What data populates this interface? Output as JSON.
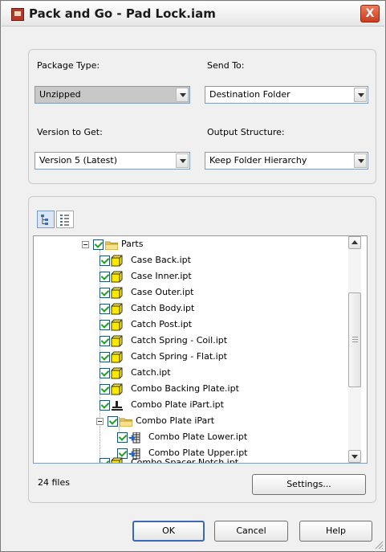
{
  "window": {
    "title": "Pack and Go - Pad Lock.iam",
    "close_label": "X",
    "icon": "app-icon"
  },
  "options": {
    "package_type": {
      "label": "Package Type:",
      "value": "Unzipped"
    },
    "send_to": {
      "label": "Send To:",
      "value": "Destination Folder"
    },
    "version": {
      "label": "Version to Get:",
      "value": "Version 5 (Latest)"
    },
    "output_structure": {
      "label": "Output Structure:",
      "value": "Keep Folder Hierarchy"
    }
  },
  "view_buttons": [
    {
      "name": "tree-view-icon",
      "active": true
    },
    {
      "name": "list-view-icon",
      "active": false
    }
  ],
  "tree": {
    "items": [
      {
        "label": "Parts",
        "type": "folder",
        "level": 0,
        "expanded": true,
        "checked": true
      },
      {
        "label": "Case Back.ipt",
        "type": "part",
        "level": 1,
        "checked": true
      },
      {
        "label": "Case Inner.ipt",
        "type": "part",
        "level": 1,
        "checked": true
      },
      {
        "label": "Case Outer.ipt",
        "type": "part",
        "level": 1,
        "checked": true
      },
      {
        "label": "Catch Body.ipt",
        "type": "part",
        "level": 1,
        "checked": true
      },
      {
        "label": "Catch Post.ipt",
        "type": "part",
        "level": 1,
        "checked": true
      },
      {
        "label": "Catch Spring - Coil.ipt",
        "type": "part",
        "level": 1,
        "checked": true
      },
      {
        "label": "Catch Spring - Flat.ipt",
        "type": "part",
        "level": 1,
        "checked": true
      },
      {
        "label": "Catch.ipt",
        "type": "part",
        "level": 1,
        "checked": true
      },
      {
        "label": "Combo Backing Plate.ipt",
        "type": "part",
        "level": 1,
        "checked": true
      },
      {
        "label": "Combo Plate iPart.ipt",
        "type": "ipart",
        "level": 1,
        "checked": true
      },
      {
        "label": "Combo Plate iPart",
        "type": "folder",
        "level": 1,
        "expanded": true,
        "checked": true
      },
      {
        "label": "Combo Plate Lower.ipt",
        "type": "member",
        "level": 2,
        "checked": true
      },
      {
        "label": "Combo Plate Upper.ipt",
        "type": "member",
        "level": 2,
        "checked": true
      },
      {
        "label": "Combo Spacer Notch.ipt",
        "type": "part",
        "level": 1,
        "checked": true
      }
    ]
  },
  "file_count": "24 files",
  "buttons": {
    "settings": "Settings...",
    "ok": "OK",
    "cancel": "Cancel",
    "help": "Help"
  }
}
